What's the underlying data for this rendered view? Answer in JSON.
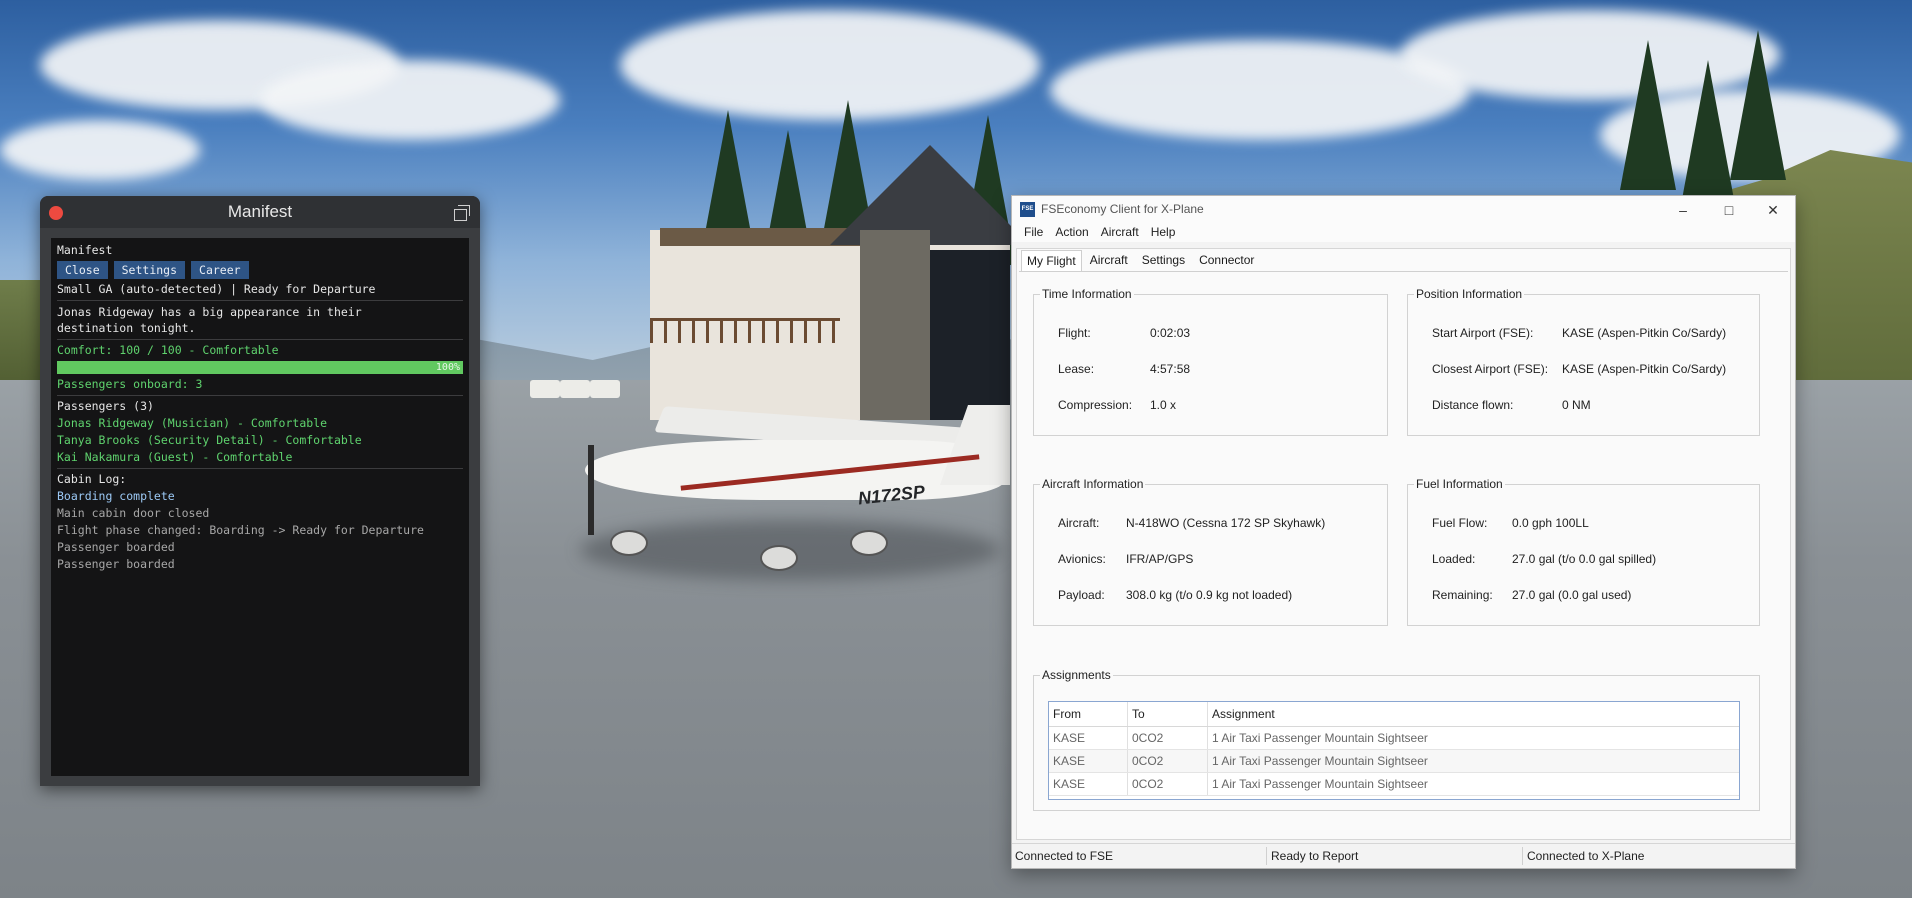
{
  "manifest": {
    "window_title": "Manifest",
    "heading": "Manifest",
    "buttons": {
      "close": "Close",
      "settings": "Settings",
      "career": "Career"
    },
    "status_line": "Small GA (auto-detected) | Ready for Departure",
    "message": "Jonas Ridgeway has a big appearance in their destination tonight.",
    "comfort_line": "Comfort: 100 / 100 - Comfortable",
    "comfort_percent": 100,
    "comfort_percent_label": "100%",
    "passengers_onboard": "Passengers onboard: 3",
    "passengers_heading": "Passengers (3)",
    "passengers": [
      "Jonas Ridgeway (Musician) - Comfortable",
      "Tanya Brooks (Security Detail) - Comfortable",
      "Kai Nakamura (Guest) - Comfortable"
    ],
    "cabin_log_heading": "Cabin Log:",
    "cabin_log_highlight": "Boarding complete",
    "cabin_log": [
      "Main cabin door closed",
      "Flight phase changed: Boarding -> Ready for Departure",
      "Passenger boarded",
      "Passenger boarded"
    ]
  },
  "fse": {
    "window_title": "FSEconomy Client for X-Plane",
    "app_icon": "FSE",
    "menu": [
      "File",
      "Action",
      "Aircraft",
      "Help"
    ],
    "tabs": [
      "My Flight",
      "Aircraft",
      "Settings",
      "Connector"
    ],
    "time_info": {
      "title": "Time Information",
      "flight_label": "Flight:",
      "flight_value": "0:02:03",
      "lease_label": "Lease:",
      "lease_value": "4:57:58",
      "compression_label": "Compression:",
      "compression_value": "1.0 x"
    },
    "position_info": {
      "title": "Position Information",
      "start_label": "Start Airport (FSE):",
      "start_value": "KASE (Aspen-Pitkin Co/Sardy)",
      "closest_label": "Closest Airport (FSE):",
      "closest_value": "KASE (Aspen-Pitkin Co/Sardy)",
      "distance_label": "Distance flown:",
      "distance_value": "0 NM"
    },
    "aircraft_info": {
      "title": "Aircraft Information",
      "aircraft_label": "Aircraft:",
      "aircraft_value": "N-418WO (Cessna 172 SP Skyhawk)",
      "avionics_label": "Avionics:",
      "avionics_value": "IFR/AP/GPS",
      "payload_label": "Payload:",
      "payload_value": "308.0 kg (t/o 0.9 kg not loaded)"
    },
    "fuel_info": {
      "title": "Fuel Information",
      "flow_label": "Fuel Flow:",
      "flow_value": "0.0 gph 100LL",
      "loaded_label": "Loaded:",
      "loaded_value": "27.0 gal (t/o 0.0 gal spilled)",
      "remaining_label": "Remaining:",
      "remaining_value": "27.0 gal (0.0 gal used)"
    },
    "assignments": {
      "title": "Assignments",
      "columns": [
        "From",
        "To",
        "Assignment"
      ],
      "rows": [
        [
          "KASE",
          "0CO2",
          "1 Air Taxi Passenger Mountain Sightseer"
        ],
        [
          "KASE",
          "0CO2",
          "1 Air Taxi Passenger Mountain Sightseer"
        ],
        [
          "KASE",
          "0CO2",
          "1 Air Taxi Passenger Mountain Sightseer"
        ]
      ]
    },
    "status_bar": [
      "Connected to FSE",
      "Ready to Report",
      "Connected to X-Plane"
    ]
  },
  "scene": {
    "aircraft_registration": "N172SP"
  }
}
